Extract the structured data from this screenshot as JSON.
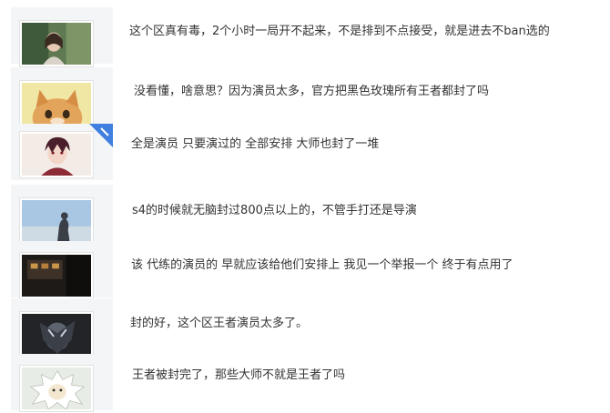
{
  "comments": [
    {
      "text": "这个区真有毒，2个小时一局开不起来，不是排到不点接受，就是进去不ban选的",
      "avatar": "avatar-girl-green-photo"
    },
    {
      "text": "没看懂，啥意思？因为演员太多，官方把黑色玫瑰所有王者都封了吗",
      "avatar": "avatar-cat-photo"
    },
    {
      "text": "全是演员 只要演过的 全部安排 大师也封了一堆",
      "avatar": "avatar-anime-boy"
    },
    {
      "text": "s4的时候就无脑封过800点以上的，不管手打还是导演",
      "avatar": "avatar-sky-silhouette"
    },
    {
      "text": "该 代练的演员的 早就应该给他们安排上 我见一个举报一个 终于有点用了",
      "avatar": "avatar-dark-street-photo"
    },
    {
      "text": "封的好，这个区王者演员太多了。",
      "avatar": "avatar-dark-anime"
    },
    {
      "text": "王者被封完了，那些大师不就是王者了吗",
      "avatar": "avatar-white-lion"
    }
  ],
  "colors": {
    "text": "#333333",
    "panel": "#f4f5f7",
    "ribbon": "#3f7fe0"
  }
}
